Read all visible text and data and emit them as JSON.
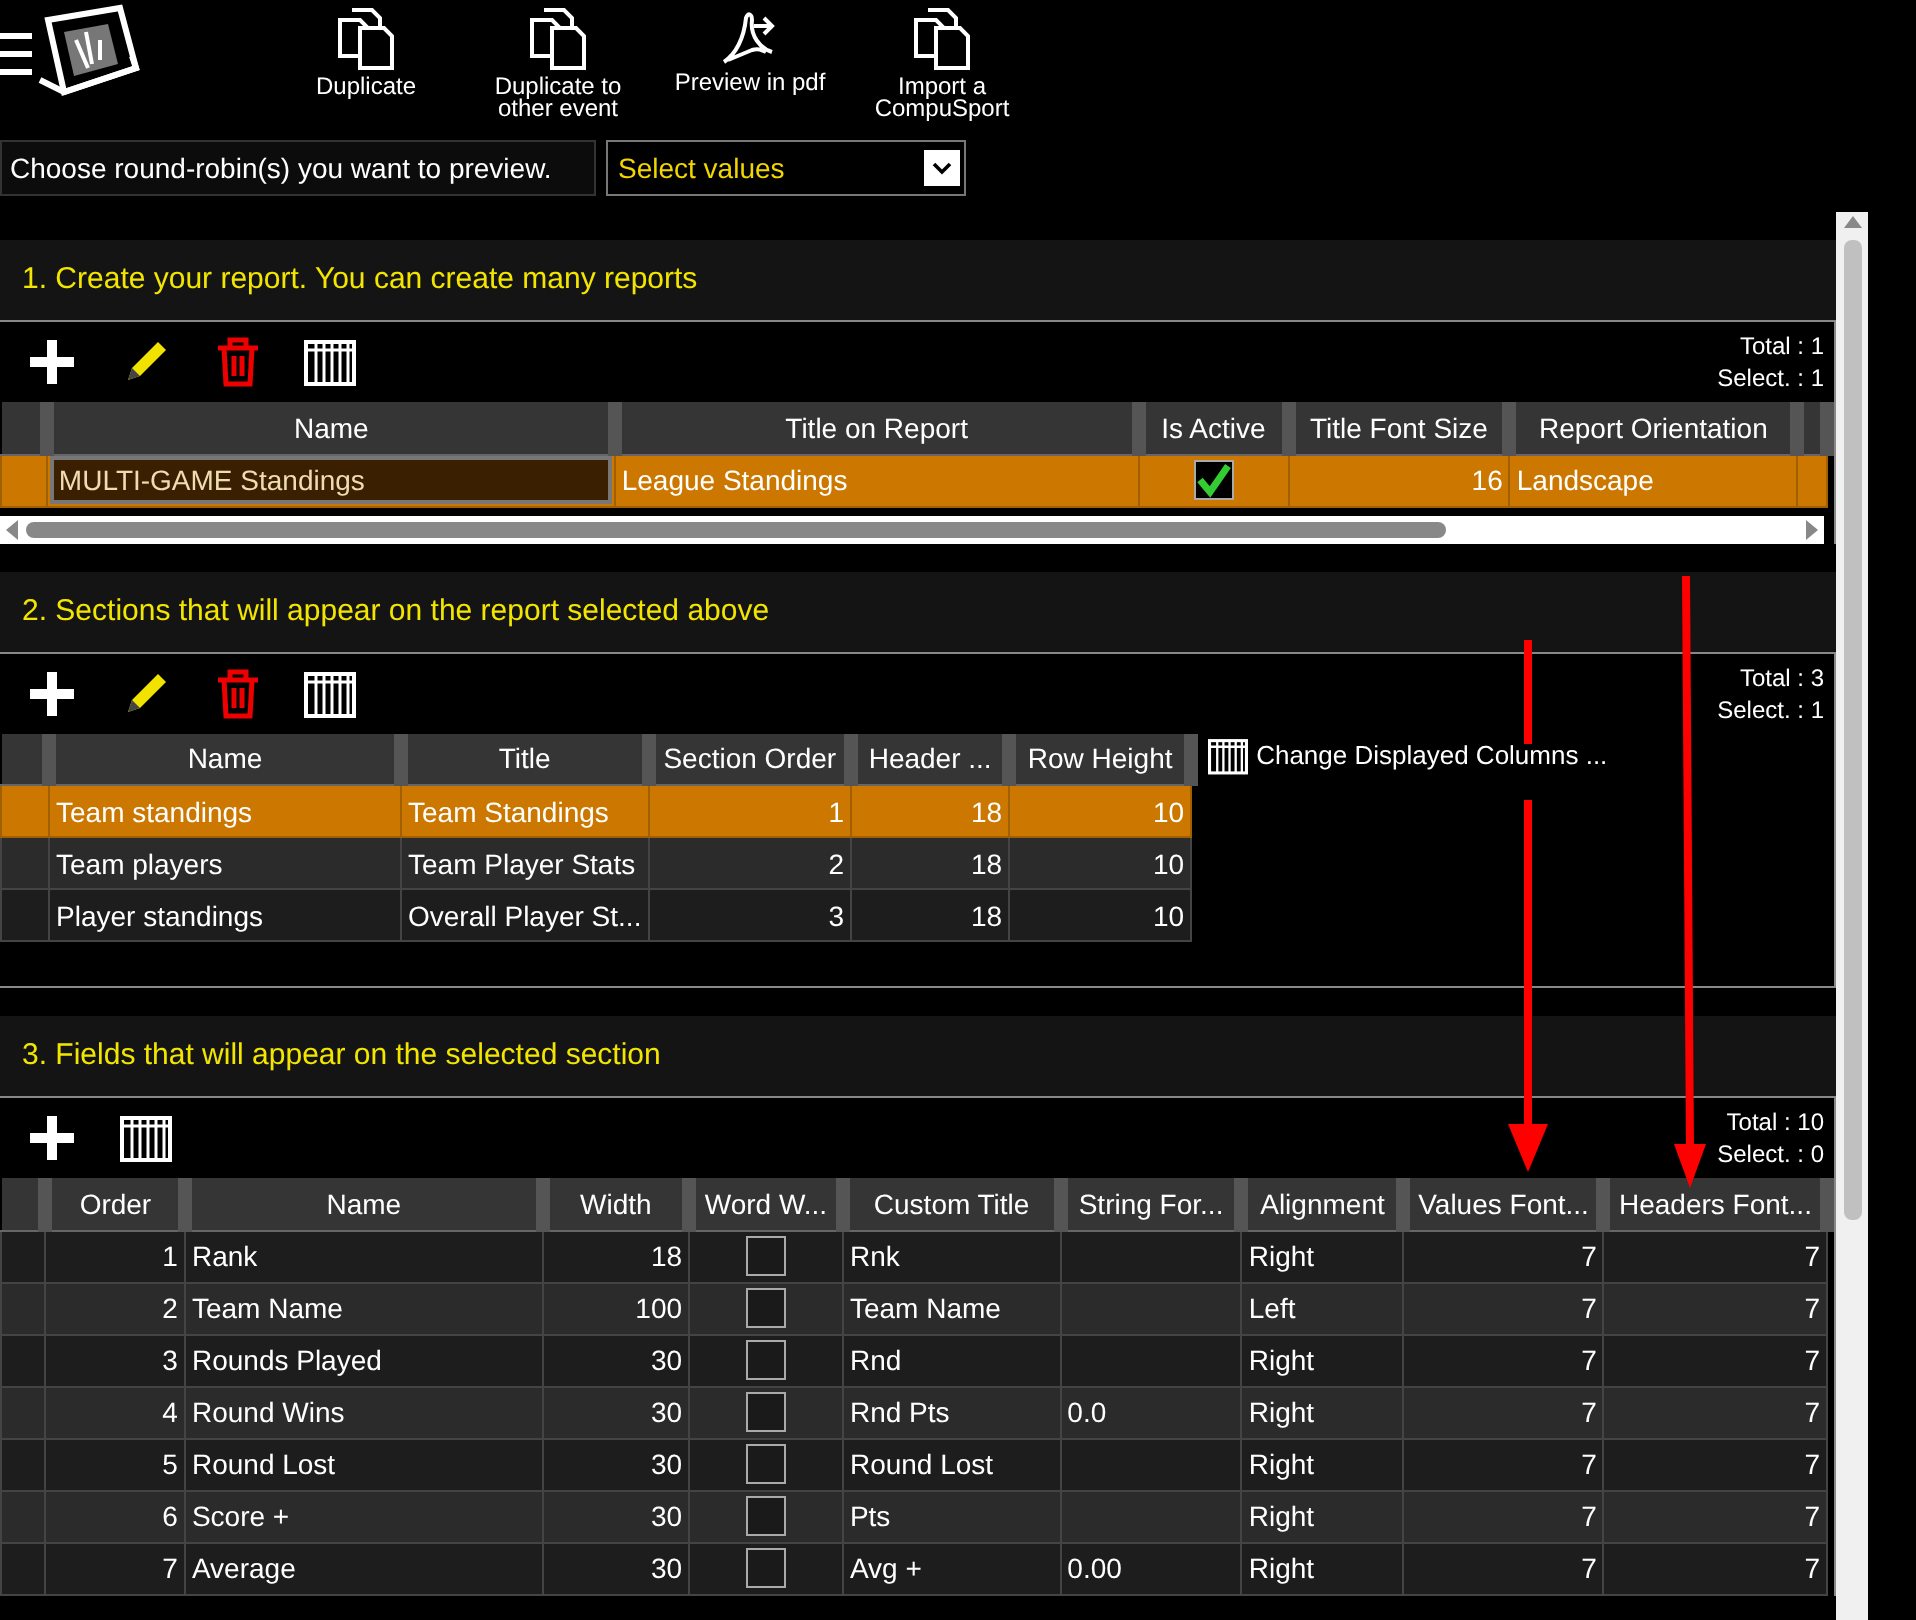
{
  "toolbar": {
    "buttons": [
      {
        "kind": "copy",
        "label": "Duplicate"
      },
      {
        "kind": "copy",
        "label": "Duplicate to\nother event"
      },
      {
        "kind": "pdf",
        "label": "Preview in pdf"
      },
      {
        "kind": "copy",
        "label": "Import a\nCompuSport"
      }
    ]
  },
  "filter": {
    "label": "Choose round-robin(s) you want to preview.",
    "placeholder": "Select values"
  },
  "sections": [
    {
      "title": "1. Create your report. You can create many reports",
      "tools": [
        {
          "kind": "add"
        },
        {
          "kind": "edit"
        },
        {
          "kind": "delete"
        },
        {
          "kind": "columns"
        }
      ],
      "total": "Total : 1",
      "selected_count": "Select. : 1",
      "table": {
        "columns": [
          {
            "label": "Name",
            "kind": "text"
          },
          {
            "label": "Title on Report",
            "kind": "text"
          },
          {
            "label": "Is Active",
            "kind": "checkbox"
          },
          {
            "label": "Title Font Size",
            "kind": "number"
          },
          {
            "label": "Report Orientation",
            "kind": "text"
          }
        ],
        "rows": [
          {
            "selected": true,
            "editing": true,
            "cells": [
              "MULTI-GAME Standings",
              "League Standings",
              {
                "checked": true
              },
              "16",
              "Landscape"
            ]
          }
        ]
      },
      "hscroll": true
    },
    {
      "title": "2. Sections that will appear on the report selected above",
      "tools": [
        {
          "kind": "add"
        },
        {
          "kind": "edit"
        },
        {
          "kind": "delete"
        },
        {
          "kind": "columns"
        }
      ],
      "total": "Total : 3",
      "selected_count": "Select. : 1",
      "table": {
        "columns": [
          {
            "label": "Name",
            "kind": "text"
          },
          {
            "label": "Title",
            "kind": "text"
          },
          {
            "label": "Section Order",
            "kind": "number"
          },
          {
            "label": "Header ...",
            "kind": "number"
          },
          {
            "label": "Row Height",
            "kind": "number"
          }
        ],
        "rows": [
          {
            "selected": true,
            "cells": [
              "Team standings",
              "Team Standings",
              "1",
              "18",
              "10"
            ]
          },
          {
            "selected": false,
            "cells": [
              "Team players",
              "Team Player Stats",
              "2",
              "18",
              "10"
            ]
          },
          {
            "selected": false,
            "cells": [
              "Player standings",
              "Overall Player St...",
              "3",
              "18",
              "10"
            ]
          }
        ]
      },
      "columns_link": "Change Displayed Columns ..."
    },
    {
      "title": "3. Fields that will appear on the selected section",
      "tools": [
        {
          "kind": "add"
        },
        {
          "kind": "columns"
        }
      ],
      "total": "Total : 10",
      "selected_count": "Select. : 0",
      "table": {
        "columns": [
          {
            "label": "Order",
            "kind": "number"
          },
          {
            "label": "Name",
            "kind": "text"
          },
          {
            "label": "Width",
            "kind": "number"
          },
          {
            "label": "Word W...",
            "kind": "checkbox"
          },
          {
            "label": "Custom Title",
            "kind": "text"
          },
          {
            "label": "String For...",
            "kind": "text"
          },
          {
            "label": "Alignment",
            "kind": "text"
          },
          {
            "label": "Values Font...",
            "kind": "number"
          },
          {
            "label": "Headers Font...",
            "kind": "number"
          }
        ],
        "rows": [
          {
            "selected": false,
            "cells": [
              "1",
              "Rank",
              "18",
              {
                "checked": false
              },
              "Rnk",
              "",
              "Right",
              "7",
              "7"
            ]
          },
          {
            "selected": false,
            "cells": [
              "2",
              "Team Name",
              "100",
              {
                "checked": false
              },
              "Team Name",
              "",
              "Left",
              "7",
              "7"
            ]
          },
          {
            "selected": false,
            "cells": [
              "3",
              "Rounds Played",
              "30",
              {
                "checked": false
              },
              "Rnd",
              "",
              "Right",
              "7",
              "7"
            ]
          },
          {
            "selected": false,
            "cells": [
              "4",
              "Round Wins",
              "30",
              {
                "checked": false
              },
              "Rnd Pts",
              "0.0",
              "Right",
              "7",
              "7"
            ]
          },
          {
            "selected": false,
            "cells": [
              "5",
              "Round Lost",
              "30",
              {
                "checked": false
              },
              "Round Lost",
              "",
              "Right",
              "7",
              "7"
            ]
          },
          {
            "selected": false,
            "cells": [
              "6",
              "Score +",
              "30",
              {
                "checked": false
              },
              "Pts",
              "",
              "Right",
              "7",
              "7"
            ]
          },
          {
            "selected": false,
            "cells": [
              "7",
              "Average",
              "30",
              {
                "checked": false
              },
              "Avg +",
              "0.00",
              "Right",
              "7",
              "7"
            ]
          }
        ]
      }
    }
  ]
}
